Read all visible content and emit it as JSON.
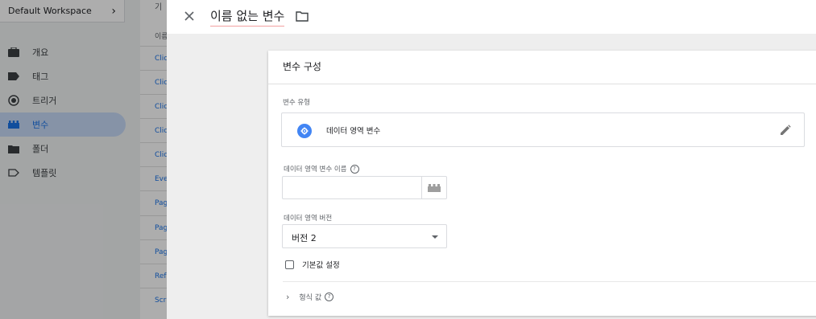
{
  "workspace": {
    "name": "Default Workspace"
  },
  "sidebar": {
    "items": [
      {
        "label": "개요",
        "icon": "briefcase-icon",
        "active": false
      },
      {
        "label": "태그",
        "icon": "tag-icon",
        "active": false
      },
      {
        "label": "트리거",
        "icon": "trigger-icon",
        "active": false
      },
      {
        "label": "변수",
        "icon": "variables-icon",
        "active": true
      },
      {
        "label": "폴더",
        "icon": "folder-icon",
        "active": false
      },
      {
        "label": "템플릿",
        "icon": "template-icon",
        "active": false
      }
    ]
  },
  "list": {
    "top_label": "기",
    "header": "이름",
    "rows": [
      "Clic",
      "Clic",
      "Clic",
      "Clic",
      "Clic",
      "Eve",
      "Pag",
      "Pag",
      "Pag",
      "Ref",
      "Scr"
    ]
  },
  "editor": {
    "title": "이름 없는 변수",
    "card_title": "변수 구성",
    "variable_type_label": "변수 유형",
    "variable_type_value": "데이터 영역 변수",
    "dl_name_label": "데이터 영역 변수 이름",
    "dl_name_value": "",
    "dl_version_label": "데이터 영역 버전",
    "dl_version_value": "버전 2",
    "default_value_label": "기본값 설정",
    "format_value_label": "형식 값",
    "help_glyph": "?"
  },
  "colors": {
    "accent": "#1a73e8",
    "active_bg": "#c6d9f7",
    "type_icon": "#4285f4"
  }
}
